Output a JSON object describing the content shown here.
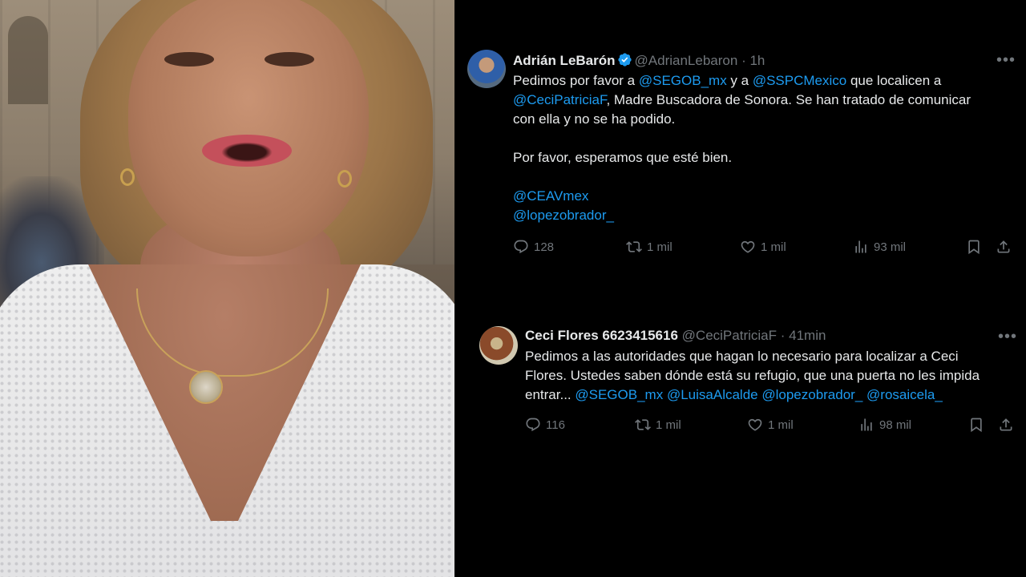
{
  "tweets": [
    {
      "name": "Adrián LeBarón",
      "handle": "@AdrianLebaron",
      "separator": "·",
      "time": "1h",
      "verified": true,
      "text_lines": [
        [
          {
            "t": "Pedimos por favor a "
          },
          {
            "t": "@SEGOB_mx",
            "m": true
          },
          {
            "t": " y a "
          },
          {
            "t": "@SSPCMexico",
            "m": true
          },
          {
            "t": " que localicen a"
          }
        ],
        [
          {
            "t": "@CeciPatriciaF",
            "m": true
          },
          {
            "t": ", Madre Buscadora de Sonora. Se han tratado de comunicar"
          }
        ],
        [
          {
            "t": "con ella y no se ha podido."
          }
        ],
        [
          {
            "t": ""
          }
        ],
        [
          {
            "t": "Por favor, esperamos que esté bien."
          }
        ],
        [
          {
            "t": ""
          }
        ],
        [
          {
            "t": "@CEAVmex",
            "m": true
          }
        ],
        [
          {
            "t": "@lopezobrador_",
            "m": true
          }
        ]
      ],
      "replies": "128",
      "reposts": "1 mil",
      "likes": "1 mil",
      "views": "93 mil"
    },
    {
      "name": "Ceci Flores 6623415616",
      "handle": "@CeciPatriciaF",
      "separator": "·",
      "time": "41min",
      "verified": false,
      "text_lines": [
        [
          {
            "t": "Pedimos a las autoridades que hagan lo necesario para localizar a Ceci"
          }
        ],
        [
          {
            "t": "Flores. Ustedes saben dónde está su refugio, que una puerta no les impida"
          }
        ],
        [
          {
            "t": "entrar... "
          },
          {
            "t": "@SEGOB_mx",
            "m": true
          },
          {
            "t": " "
          },
          {
            "t": "@LuisaAlcalde",
            "m": true
          },
          {
            "t": " "
          },
          {
            "t": "@lopezobrador_",
            "m": true
          },
          {
            "t": " "
          },
          {
            "t": "@rosaicela_",
            "m": true
          }
        ]
      ],
      "replies": "116",
      "reposts": "1 mil",
      "likes": "1 mil",
      "views": "98 mil"
    }
  ],
  "icons": [
    "more-icon",
    "verified-badge-icon",
    "reply-icon",
    "repost-icon",
    "like-icon",
    "views-icon",
    "bookmark-icon",
    "share-icon"
  ],
  "colors": {
    "background": "#000000",
    "text": "#e7e9ea",
    "muted": "#71767b",
    "accent": "#1d9bf0"
  }
}
